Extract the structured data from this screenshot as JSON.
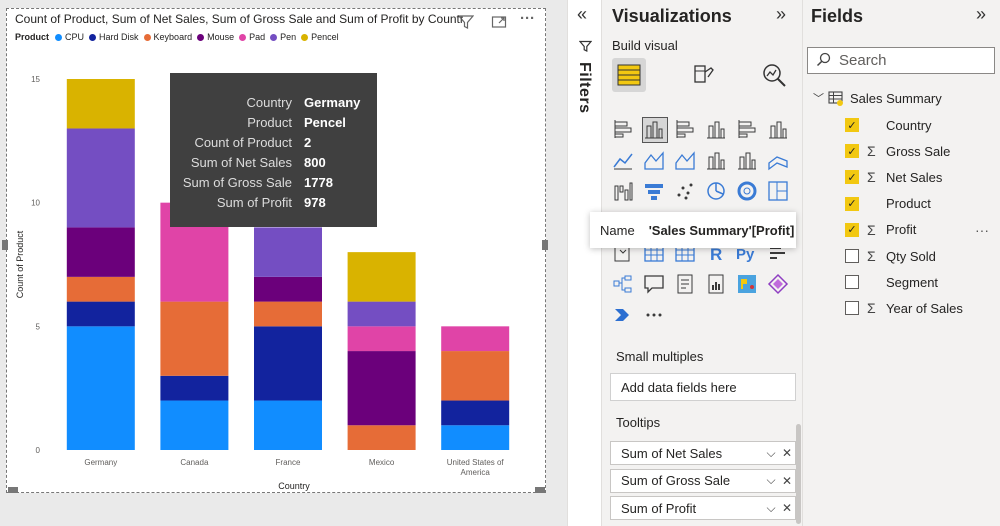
{
  "chart_data": {
    "type": "bar",
    "stacked": true,
    "title": "Count of Product, Sum of Net Sales, Sum of Gross Sale and Sum of Profit by Country a",
    "xlabel": "Country",
    "ylabel": "Count of Product",
    "ylim": [
      0,
      15
    ],
    "yticks": [
      "0",
      "5",
      "10",
      "15"
    ],
    "categories": [
      "Germany",
      "Canada",
      "France",
      "Mexico",
      "United States of America"
    ],
    "legend_title": "Product",
    "legend_position": "top-left",
    "series": [
      {
        "name": "CPU",
        "color": "#118DFF",
        "values": [
          5,
          2,
          2,
          0,
          1
        ]
      },
      {
        "name": "Hard Disk",
        "color": "#12239E",
        "values": [
          1,
          1,
          3,
          0,
          1
        ]
      },
      {
        "name": "Keyboard",
        "color": "#E66C37",
        "values": [
          1,
          3,
          1,
          1,
          2
        ]
      },
      {
        "name": "Mouse",
        "color": "#6B007B",
        "values": [
          2,
          0,
          1,
          3,
          0
        ]
      },
      {
        "name": "Pad",
        "color": "#E044A7",
        "values": [
          0,
          4,
          0,
          1,
          1
        ]
      },
      {
        "name": "Pen",
        "color": "#744EC2",
        "values": [
          4,
          0,
          2,
          1,
          0
        ]
      },
      {
        "name": "Pencel",
        "color": "#D9B300",
        "values": [
          2,
          0,
          0,
          2,
          0
        ]
      }
    ]
  },
  "tooltip": [
    {
      "key": "Country",
      "value": "Germany"
    },
    {
      "key": "Product",
      "value": "Pencel"
    },
    {
      "key": "Count of Product",
      "value": "2"
    },
    {
      "key": "Sum of Net Sales",
      "value": "800"
    },
    {
      "key": "Sum of Gross Sale",
      "value": "1778"
    },
    {
      "key": "Sum of Profit",
      "value": "978"
    }
  ],
  "filters": {
    "label": "Filters"
  },
  "visualizations": {
    "title": "Visualizations",
    "build_visual": "Build visual",
    "name_tooltip": {
      "key": "Name",
      "value": "'Sales Summary'[Profit]"
    },
    "small_multiples_label": "Small multiples",
    "small_multiples_placeholder": "Add data fields here",
    "tooltips_label": "Tooltips",
    "tooltip_fields": [
      "Sum of Net Sales",
      "Sum of Gross Sale",
      "Sum of Profit"
    ]
  },
  "fields": {
    "title": "Fields",
    "search_placeholder": "Search",
    "table_name": "Sales Summary",
    "items": [
      {
        "label": "Country",
        "checked": true,
        "sigma": false
      },
      {
        "label": "Gross Sale",
        "checked": true,
        "sigma": true
      },
      {
        "label": "Net Sales",
        "checked": true,
        "sigma": true
      },
      {
        "label": "Product",
        "checked": true,
        "sigma": false
      },
      {
        "label": "Profit",
        "checked": true,
        "sigma": true
      },
      {
        "label": "Qty Sold",
        "checked": false,
        "sigma": true
      },
      {
        "label": "Segment",
        "checked": false,
        "sigma": false
      },
      {
        "label": "Year of Sales",
        "checked": false,
        "sigma": true
      }
    ]
  }
}
